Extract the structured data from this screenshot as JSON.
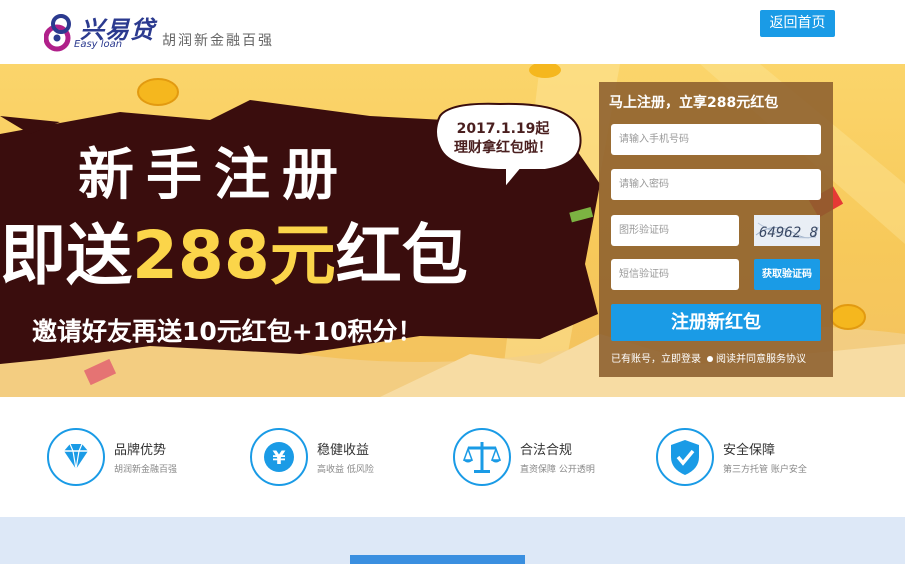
{
  "header": {
    "logo_name": "兴易贷",
    "logo_sub": "Easy loan",
    "logo_slogan": "胡润新金融百强",
    "home_button": "返回首页"
  },
  "banner": {
    "speech_line1": "2017.1.19起",
    "speech_line2": "理财拿红包啦！",
    "headline_line1": "新手注册",
    "headline_line2_prefix": "即送",
    "headline_line2_amount": "288元",
    "headline_line2_suffix": "红包",
    "headline_line3": "邀请好友再送10元红包+10积分！"
  },
  "register": {
    "title": "马上注册，立享288元红包",
    "phone_placeholder": "请输入手机号码",
    "password_placeholder": "请输入密码",
    "captcha_placeholder": "图形验证码",
    "captcha_code": "64962 8",
    "sms_placeholder": "短信验证码",
    "sms_button": "获取验证码",
    "submit_button": "注册新红包",
    "login_hint": "已有账号，立即登录",
    "agreement": "阅读并同意服务协议"
  },
  "features": [
    {
      "icon": "diamond-icon",
      "title": "品牌优势",
      "sub": "胡润新金融百强"
    },
    {
      "icon": "yen-icon",
      "title": "稳健收益",
      "sub": "高收益 低风险"
    },
    {
      "icon": "scale-icon",
      "title": "合法合规",
      "sub": "直资保障 公开透明"
    },
    {
      "icon": "shield-check-icon",
      "title": "安全保障",
      "sub": "第三方托管 账户安全"
    }
  ],
  "colors": {
    "accent_blue": "#1a9be6",
    "banner_yellow": "#f7c95a",
    "panel_brown": "#8c5f2d",
    "headline_yellow": "#fbd54a",
    "dark_burst": "#3a0d0d"
  }
}
